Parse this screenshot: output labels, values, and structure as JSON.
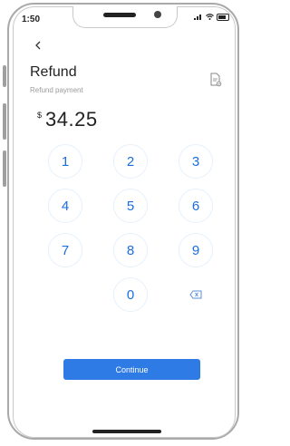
{
  "status": {
    "time": "1:50"
  },
  "header": {
    "title": "Refund",
    "subtitle": "Refund payment"
  },
  "amount": {
    "currency_symbol": "$",
    "value": "34.25"
  },
  "keypad": {
    "keys": [
      "1",
      "2",
      "3",
      "4",
      "5",
      "6",
      "7",
      "8",
      "9",
      "0"
    ]
  },
  "actions": {
    "continue_label": "Continue"
  },
  "colors": {
    "accent": "#2f7be5",
    "key_text": "#1a6ee0",
    "key_border": "#e6f0fb"
  },
  "icons": {
    "back": "chevron-left-icon",
    "receipt": "receipt-icon",
    "delete": "backspace-icon",
    "signal": "signal-icon",
    "wifi": "wifi-icon",
    "battery": "battery-icon"
  }
}
